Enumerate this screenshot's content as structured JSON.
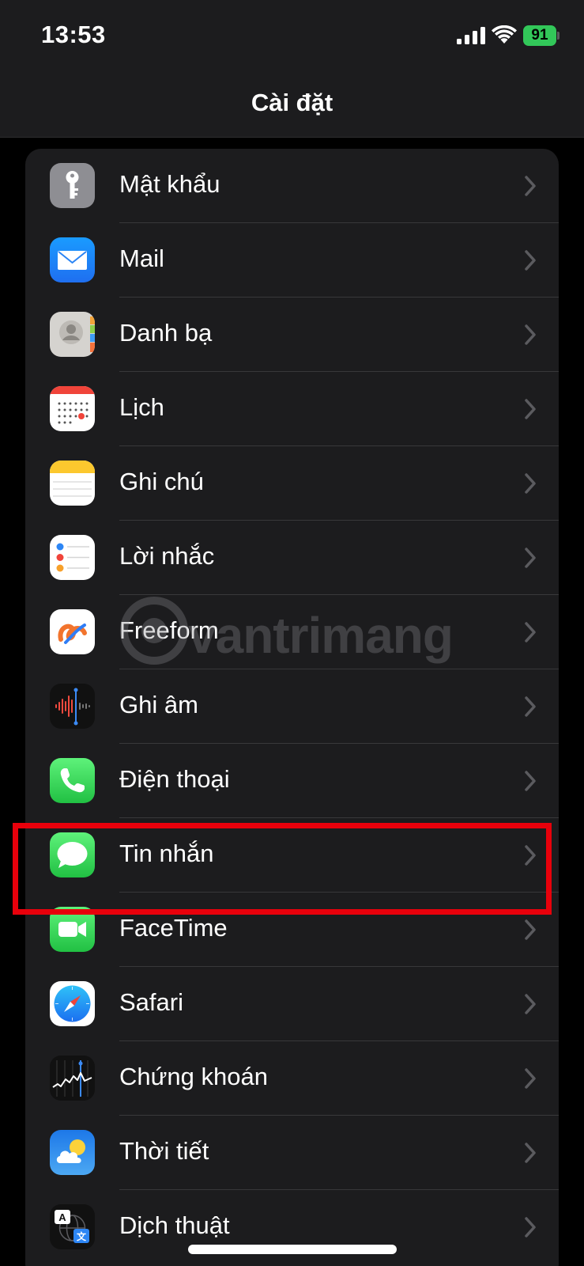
{
  "status_bar": {
    "time": "13:53",
    "battery": "91"
  },
  "nav": {
    "title": "Cài đặt"
  },
  "settings": [
    {
      "label": "Mật khẩu",
      "icon": "key-icon"
    },
    {
      "label": "Mail",
      "icon": "mail-icon"
    },
    {
      "label": "Danh bạ",
      "icon": "contacts-icon"
    },
    {
      "label": "Lịch",
      "icon": "calendar-icon"
    },
    {
      "label": "Ghi chú",
      "icon": "notes-icon"
    },
    {
      "label": "Lời nhắc",
      "icon": "reminders-icon"
    },
    {
      "label": "Freeform",
      "icon": "freeform-icon"
    },
    {
      "label": "Ghi âm",
      "icon": "voice-memos-icon"
    },
    {
      "label": "Điện thoại",
      "icon": "phone-icon"
    },
    {
      "label": "Tin nhắn",
      "icon": "messages-icon"
    },
    {
      "label": "FaceTime",
      "icon": "facetime-icon"
    },
    {
      "label": "Safari",
      "icon": "safari-icon"
    },
    {
      "label": "Chứng khoán",
      "icon": "stocks-icon"
    },
    {
      "label": "Thời tiết",
      "icon": "weather-icon"
    },
    {
      "label": "Dịch thuật",
      "icon": "translate-icon"
    }
  ],
  "highlighted_item": "Tin nhắn",
  "watermark": "vantrimang",
  "colors": {
    "background": "#000000",
    "group_background": "#1c1c1e",
    "separator": "#38383a",
    "chevron": "#5b5b5f",
    "highlight_border": "#e8000b",
    "battery": "#32c759"
  }
}
